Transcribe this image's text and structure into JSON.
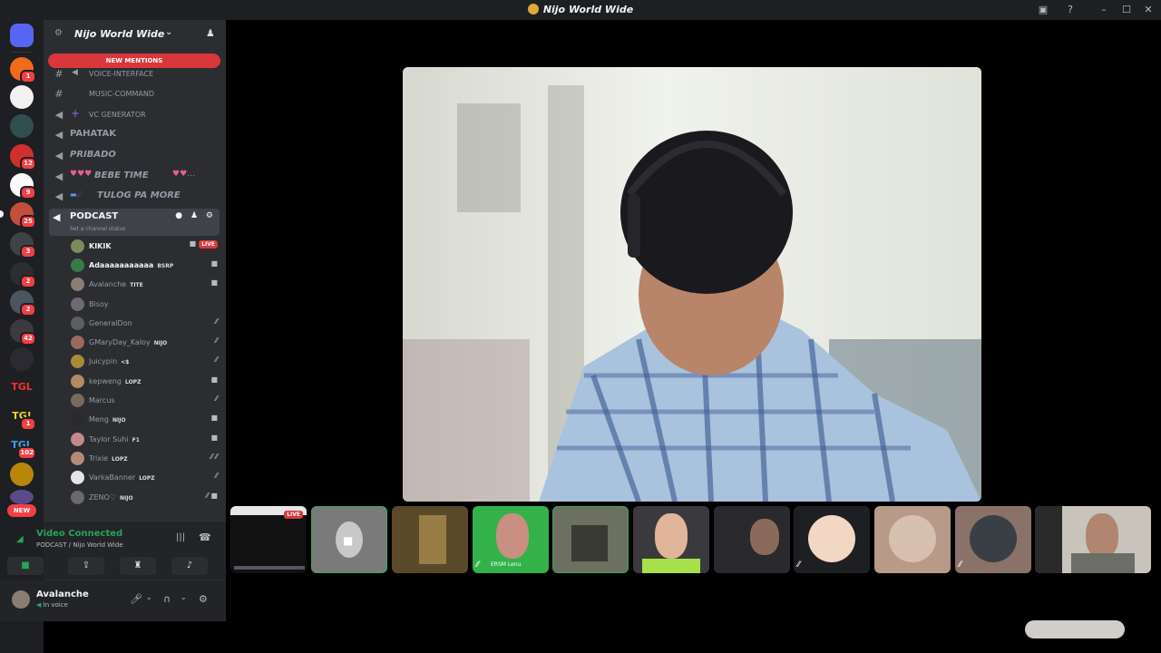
{
  "window": {
    "title": "Nijo World Wide",
    "icons": [
      "screen-share-icon",
      "help-icon",
      "minimize-icon",
      "maximize-icon",
      "close-icon"
    ]
  },
  "guild_rail": {
    "badges": [
      "1",
      "12",
      "9",
      "25",
      "3",
      "2",
      "2",
      "42",
      "1",
      "102"
    ],
    "new_label": "NEW"
  },
  "server": {
    "name": "Nijo World Wide",
    "new_mentions": "NEW MENTIONS"
  },
  "channels": [
    {
      "label": "VOICE-INTERFACE",
      "kind": "text"
    },
    {
      "label": "MUSIC-COMMAND",
      "kind": "text"
    },
    {
      "label": "VC GENERATOR",
      "kind": "voice"
    },
    {
      "label": "PAHATAK",
      "kind": "voice-big"
    },
    {
      "label": "PRIBADO",
      "kind": "voice-big"
    },
    {
      "label": "BEBE TIME",
      "kind": "voice-big"
    },
    {
      "label": "TULOG PA MORE",
      "kind": "voice-big"
    }
  ],
  "podcast": {
    "label": "PODCAST",
    "status": "Set a channel status"
  },
  "voice_users": [
    {
      "name": "KIKIK",
      "tag": "",
      "live": "LIVE",
      "color": "#7b8b5c"
    },
    {
      "name": "Adaaaaaaaaaaa",
      "tag": "BSRP",
      "live": "",
      "color": "#3a7a4a"
    },
    {
      "name": "Avalanche",
      "tag": "TITE",
      "live": "",
      "color": "#8a7d72"
    },
    {
      "name": "Bisoy",
      "tag": "",
      "live": "",
      "color": "#6d6a70"
    },
    {
      "name": "GeneralDon",
      "tag": "",
      "live": "",
      "color": "#5a5f66"
    },
    {
      "name": "GMaryDay_Kaloy",
      "tag": "NIJO",
      "live": "",
      "color": "#9a6a5e"
    },
    {
      "name": "Juicypin",
      "tag": "<$",
      "live": "",
      "color": "#a88a3a"
    },
    {
      "name": "kepweng",
      "tag": "LOPZ",
      "live": "",
      "color": "#b28a64"
    },
    {
      "name": "Marcus",
      "tag": "",
      "live": "",
      "color": "#7a6a5e"
    },
    {
      "name": "Meng",
      "tag": "NIJO",
      "live": "",
      "color": "#2a2a2a"
    },
    {
      "name": "Taylor Suhi",
      "tag": "F1",
      "live": "",
      "color": "#c28a8a"
    },
    {
      "name": "Trixie",
      "tag": "LOPZ",
      "live": "",
      "color": "#b58a7a"
    },
    {
      "name": "VarkaBanner",
      "tag": "LOPZ",
      "live": "",
      "color": "#e5e5e5"
    },
    {
      "name": "ZENO♡",
      "tag": "NIJO",
      "live": "",
      "color": "#6a6a6a"
    }
  ],
  "voice_panel": {
    "title": "Video Connected",
    "subtitle": "PODCAST / Nijo World Wide"
  },
  "user_panel": {
    "name": "Avalanche",
    "status": "In voice"
  },
  "tiles": {
    "live_label": "LIVE",
    "tile4_label": "ERSM Lenu"
  }
}
